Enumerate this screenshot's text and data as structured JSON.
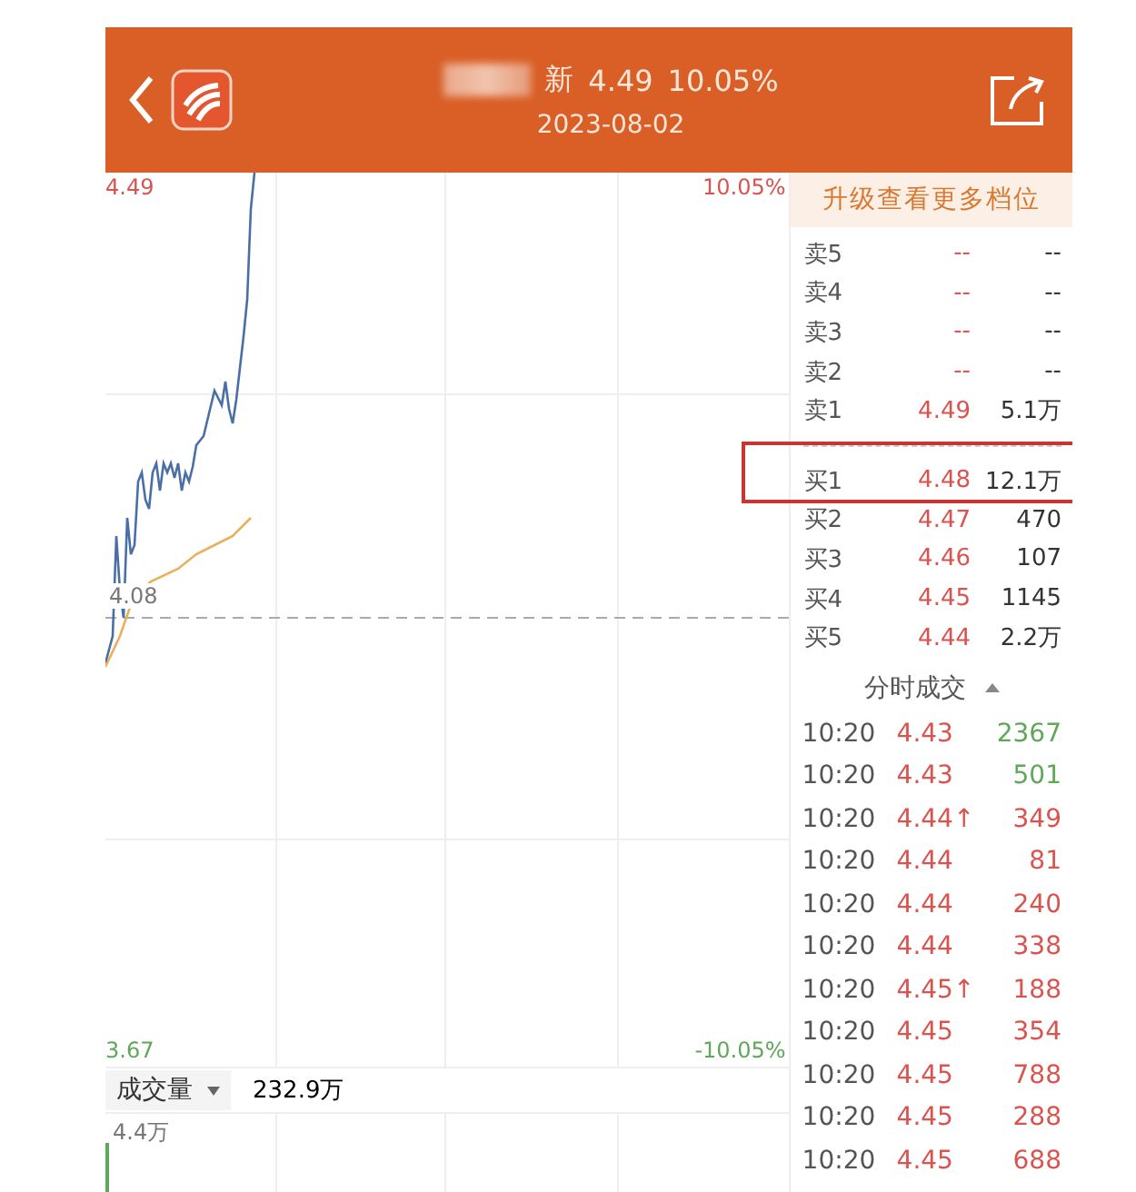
{
  "header": {
    "name_tail": "新",
    "price": "4.49",
    "change": "10.05%",
    "date": "2023-08-02"
  },
  "chart": {
    "top_price": "4.49",
    "top_pct": "10.05%",
    "mid_price": "4.08",
    "bottom_price": "3.67",
    "bottom_pct": "-10.05%"
  },
  "volume": {
    "selector": "成交量",
    "total": "232.9万",
    "max": "4.4万"
  },
  "upgrade_banner": "升级查看更多档位",
  "asks": [
    {
      "label": "卖5",
      "price": "--",
      "volume": "--"
    },
    {
      "label": "卖4",
      "price": "--",
      "volume": "--"
    },
    {
      "label": "卖3",
      "price": "--",
      "volume": "--"
    },
    {
      "label": "卖2",
      "price": "--",
      "volume": "--"
    },
    {
      "label": "卖1",
      "price": "4.49",
      "volume": "5.1万"
    }
  ],
  "bids": [
    {
      "label": "买1",
      "price": "4.48",
      "volume": "12.1万",
      "highlighted": true
    },
    {
      "label": "买2",
      "price": "4.47",
      "volume": "470",
      "highlighted": false
    },
    {
      "label": "买3",
      "price": "4.46",
      "volume": "107",
      "highlighted": false
    },
    {
      "label": "买4",
      "price": "4.45",
      "volume": "1145",
      "highlighted": false
    },
    {
      "label": "买5",
      "price": "4.44",
      "volume": "2.2万",
      "highlighted": false
    }
  ],
  "trades_header": "分时成交",
  "trades": [
    {
      "time": "10:20",
      "price": "4.43",
      "volume": "2367",
      "color": "#5fa85a"
    },
    {
      "time": "10:20",
      "price": "4.43",
      "volume": "501",
      "color": "#5fa85a"
    },
    {
      "time": "10:20",
      "price": "4.44↑",
      "volume": "349",
      "color": "#d9534f"
    },
    {
      "time": "10:20",
      "price": "4.44",
      "volume": "81",
      "color": "#d9534f"
    },
    {
      "time": "10:20",
      "price": "4.44",
      "volume": "240",
      "color": "#d9534f"
    },
    {
      "time": "10:20",
      "price": "4.44",
      "volume": "338",
      "color": "#d9534f"
    },
    {
      "time": "10:20",
      "price": "4.45↑",
      "volume": "188",
      "color": "#d9534f"
    },
    {
      "time": "10:20",
      "price": "4.45",
      "volume": "354",
      "color": "#d9534f"
    },
    {
      "time": "10:20",
      "price": "4.45",
      "volume": "788",
      "color": "#d9534f"
    },
    {
      "time": "10:20",
      "price": "4.45",
      "volume": "288",
      "color": "#d9534f"
    },
    {
      "time": "10:20",
      "price": "4.45",
      "volume": "688",
      "color": "#d9534f"
    }
  ]
}
